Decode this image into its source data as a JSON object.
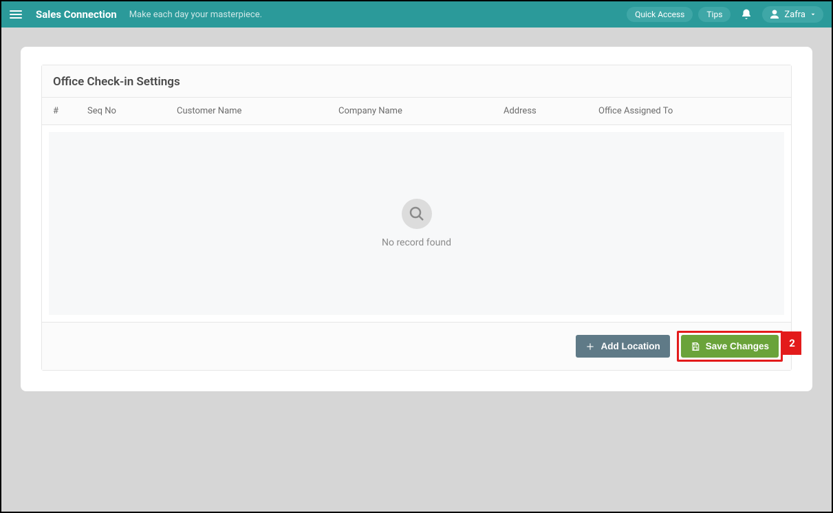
{
  "header": {
    "brand": "Sales Connection",
    "tagline": "Make each day your masterpiece.",
    "quick_access_label": "Quick Access",
    "tips_label": "Tips",
    "user_name": "Zafra"
  },
  "panel": {
    "title": "Office Check-in Settings",
    "columns": {
      "hash": "#",
      "seq_no": "Seq No",
      "customer_name": "Customer Name",
      "company_name": "Company Name",
      "address": "Address",
      "office_assigned_to": "Office Assigned To"
    },
    "empty_message": "No record found"
  },
  "footer": {
    "add_location_label": "Add Location",
    "save_changes_label": "Save Changes"
  },
  "annotation": {
    "step": "2"
  }
}
